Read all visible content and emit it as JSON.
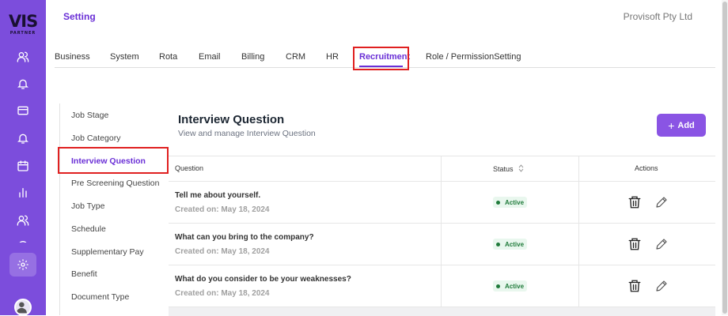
{
  "app": {
    "logo_text": "VIS",
    "logo_sub": "PARTNER",
    "page_title": "Setting",
    "company": "Provisoft Pty Ltd"
  },
  "sidebar": {
    "items": [
      {
        "icon": "users-icon"
      },
      {
        "icon": "bell-icon"
      },
      {
        "icon": "credit-card-icon"
      },
      {
        "icon": "bell-icon"
      },
      {
        "icon": "calendar-icon"
      },
      {
        "icon": "bar-chart-icon"
      },
      {
        "icon": "users-icon"
      },
      {
        "icon": "settings-gear-icon"
      }
    ],
    "active_color": "#7c4ddc"
  },
  "tabs": [
    {
      "label": "Business"
    },
    {
      "label": "System"
    },
    {
      "label": "Rota"
    },
    {
      "label": "Email"
    },
    {
      "label": "Billing"
    },
    {
      "label": "CRM"
    },
    {
      "label": "HR"
    },
    {
      "label": "Recruitment",
      "active": true
    },
    {
      "label": "Role / PermissionSetting"
    }
  ],
  "left_menu": [
    {
      "label": "Job Stage"
    },
    {
      "label": "Job Category"
    },
    {
      "label": "Interview Question",
      "active": true
    },
    {
      "label": "Pre Screening Question"
    },
    {
      "label": "Job Type"
    },
    {
      "label": "Schedule"
    },
    {
      "label": "Supplementary Pay"
    },
    {
      "label": "Benefit"
    },
    {
      "label": "Document Type"
    }
  ],
  "content": {
    "title": "Interview Question",
    "subtitle": "View and manage Interview Question",
    "add_label": "Add"
  },
  "table": {
    "headers": {
      "question": "Question",
      "status": "Status",
      "actions": "Actions"
    },
    "rows": [
      {
        "question": "Tell me about yourself.",
        "created": "Created on: May 18, 2024",
        "status": "Active"
      },
      {
        "question": "What can you bring to the company?",
        "created": "Created on: May 18, 2024",
        "status": "Active"
      },
      {
        "question": "What do you consider to be your weaknesses?",
        "created": "Created on: May 18, 2024",
        "status": "Active"
      }
    ]
  },
  "colors": {
    "brand_purple": "#6a2fd6",
    "button_purple": "#8a54e4",
    "highlight_red": "#e02020",
    "status_green": "#1f7a3a"
  }
}
